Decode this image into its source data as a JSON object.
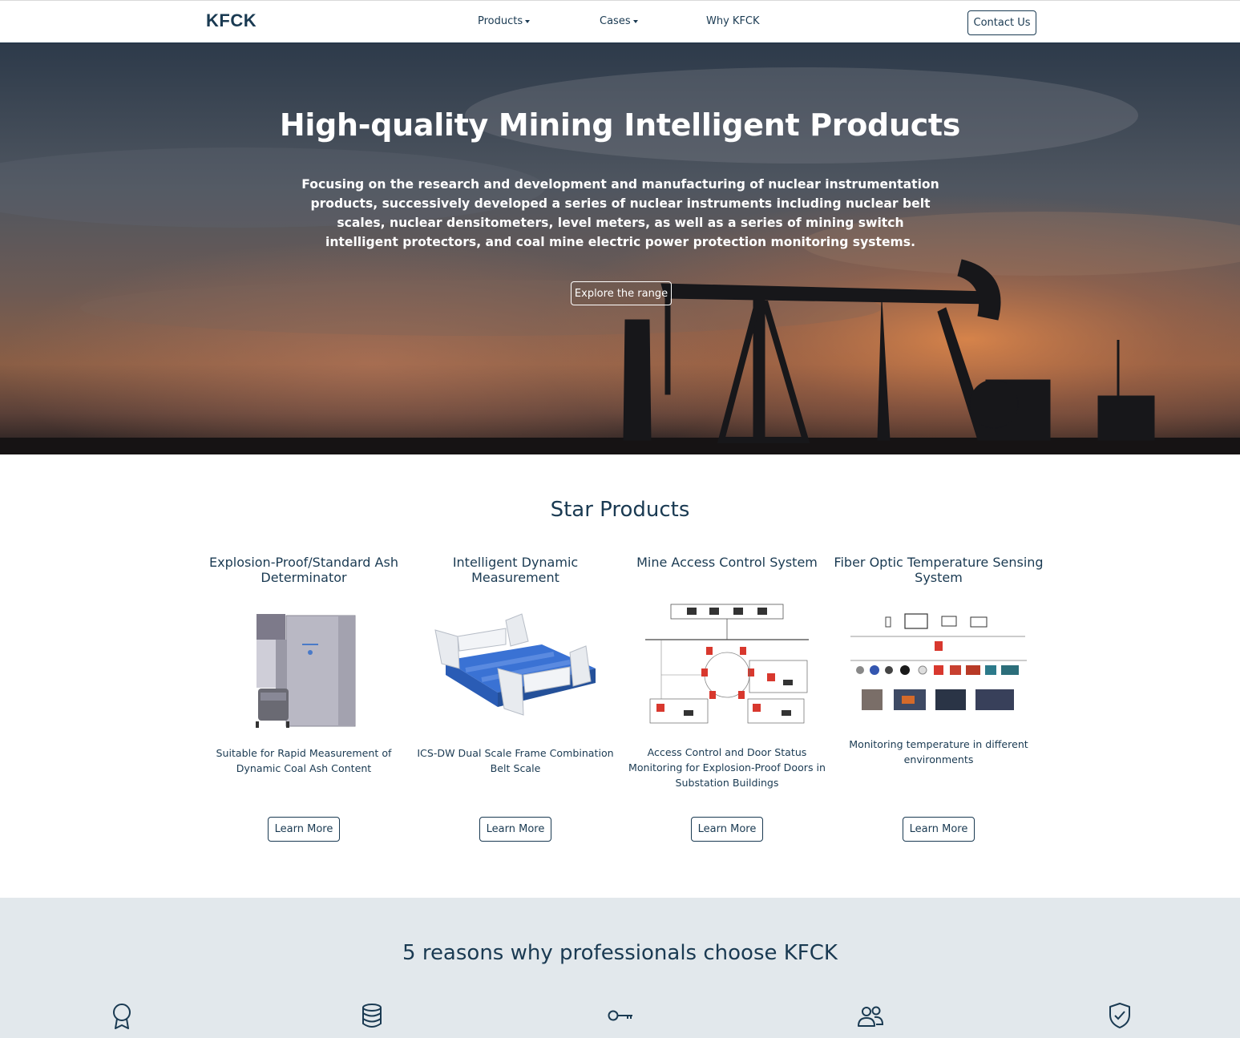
{
  "brand": "KFCK",
  "nav": {
    "products_label": "Products",
    "cases_label": "Cases",
    "why_label": "Why KFCK",
    "contact_label": "Contact Us"
  },
  "hero": {
    "title": "High-quality Mining Intelligent Products",
    "subtitle": "Focusing on the research and development and manufacturing of nuclear instrumentation products, successively developed a series of nuclear instruments including nuclear belt scales, nuclear densitometers, level meters, as well as a series of mining switch intelligent protectors, and coal mine electric power protection monitoring systems.",
    "cta_label": "Explore the range"
  },
  "star_products": {
    "title": "Star Products",
    "items": [
      {
        "name": "Explosion-Proof/Standard Ash Determinator",
        "description": "Suitable for Rapid Measurement of Dynamic Coal Ash Content",
        "button": "Learn More",
        "image": "ash-determinator-machine"
      },
      {
        "name": "Intelligent Dynamic Measurement",
        "description": "ICS-DW Dual Scale Frame Combination Belt Scale",
        "button": "Learn More",
        "image": "belt-scale-frame"
      },
      {
        "name": "Mine Access Control System",
        "description": "Access Control and Door Status Monitoring for Explosion-Proof Doors in Substation Buildings",
        "button": "Learn More",
        "image": "access-control-diagram"
      },
      {
        "name": "Fiber Optic Temperature Sensing System",
        "description": "Monitoring temperature in different environments",
        "button": "Learn More",
        "image": "temperature-sensing-diagram"
      }
    ]
  },
  "reasons": {
    "title": "5 reasons why professionals choose KFCK",
    "icons": [
      "award-icon",
      "database-icon",
      "key-icon",
      "users-icon",
      "shield-check-icon"
    ]
  },
  "colors": {
    "primary": "#1a3a52",
    "reasons_bg": "#e2e8ec",
    "hero_text": "#ffffff"
  }
}
